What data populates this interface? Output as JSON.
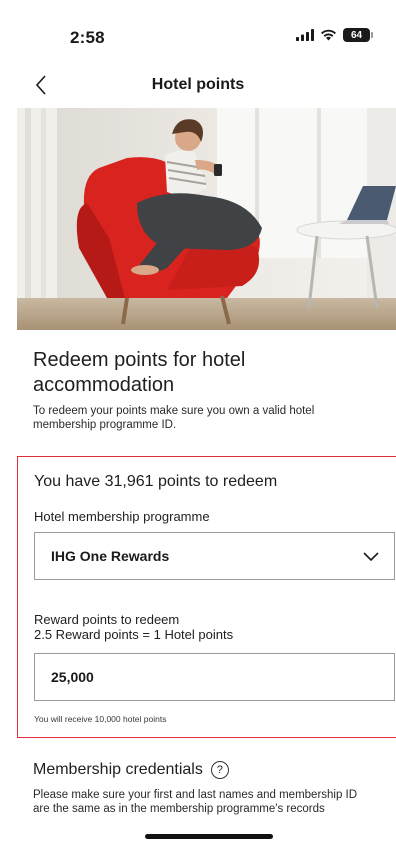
{
  "status_bar": {
    "time": "2:58",
    "battery": "64"
  },
  "nav": {
    "title": "Hotel points",
    "back_icon": "chevron-left-icon"
  },
  "hero": {
    "icon": "hero-photo"
  },
  "intro": {
    "title": "Redeem points for hotel accommodation",
    "text": "To redeem your points make sure you own a valid hotel membership programme ID."
  },
  "redeem": {
    "heading": "You have 31,961 points to redeem",
    "programme_label": "Hotel membership programme",
    "programme_value": "IHG One Rewards",
    "reward_label": "Reward points to redeem",
    "rate": "2.5 Reward points = 1 Hotel points",
    "reward_value": "25,000",
    "receive_note": "You will receive 10,000 hotel points"
  },
  "credentials": {
    "title": "Membership credentials",
    "help_symbol": "?",
    "text": "Please make sure your first and last names and membership ID are the same as in the membership programme's records"
  },
  "colors": {
    "highlight_border": "#e0303a",
    "chair": "#d8231f"
  }
}
